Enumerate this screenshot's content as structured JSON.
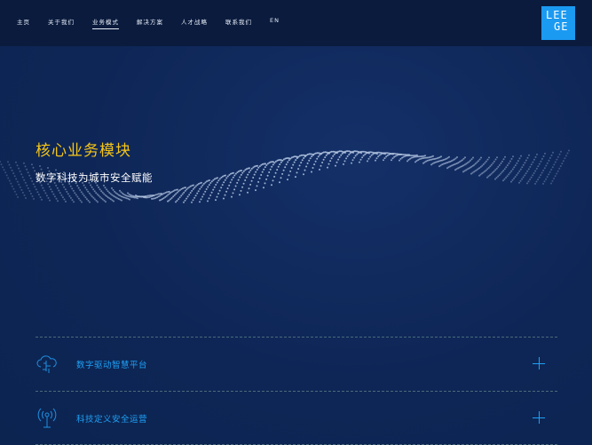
{
  "nav": {
    "items": [
      "主页",
      "关于我们",
      "业务模式",
      "解决方案",
      "人才战略",
      "联系我们",
      "EN"
    ],
    "active": 2
  },
  "logo": {
    "line1": "LEE",
    "line2": "GE"
  },
  "hero": {
    "title": "核心业务模块",
    "subtitle": "数字科技为城市安全赋能"
  },
  "modules": [
    {
      "label": "数字驱动智慧平台",
      "icon": "cloud-circuit-icon"
    },
    {
      "label": "科技定义安全运营",
      "icon": "signal-tower-icon"
    }
  ],
  "colors": {
    "accent": "#1ea0f5",
    "title": "#f5c518",
    "header": "#0a1b3e",
    "logo": "#1b9af2"
  }
}
